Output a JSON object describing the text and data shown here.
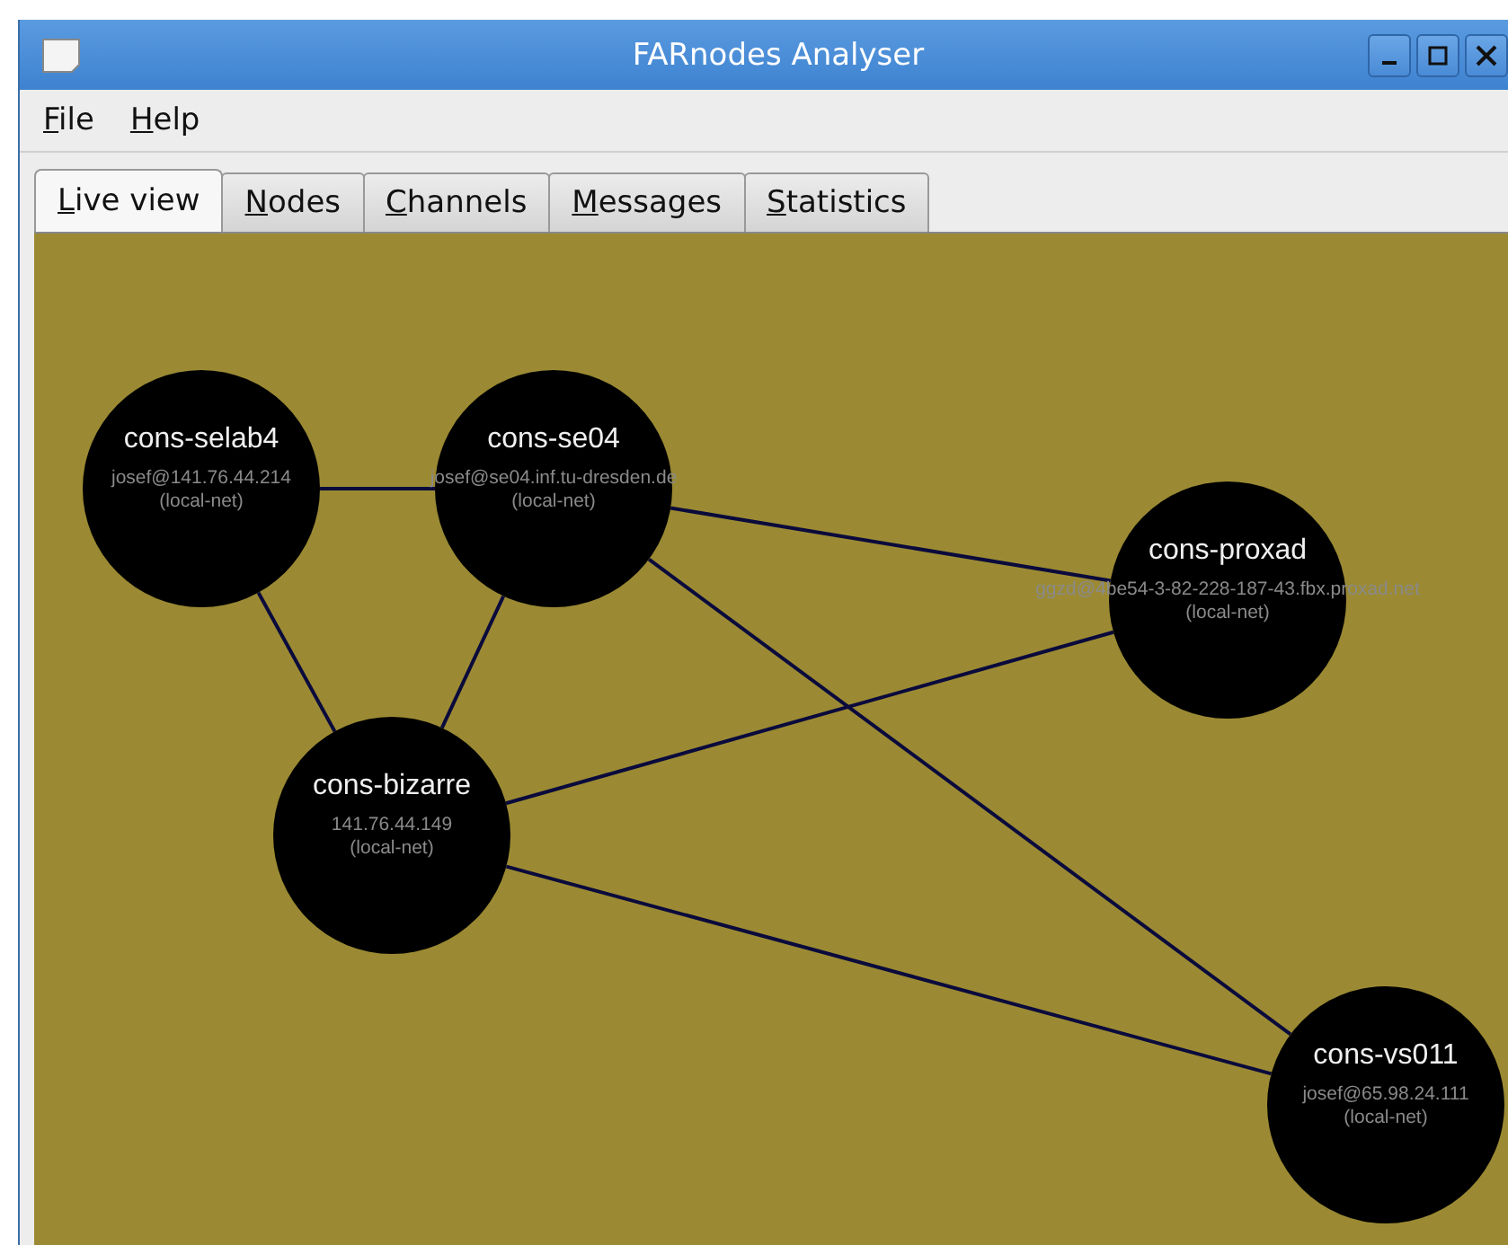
{
  "window": {
    "title": "FARnodes Analyser"
  },
  "menu": [
    {
      "label": "File"
    },
    {
      "label": "Help"
    }
  ],
  "tabs": [
    {
      "label": "Live view",
      "selected": true
    },
    {
      "label": "Nodes",
      "selected": false
    },
    {
      "label": "Channels",
      "selected": false
    },
    {
      "label": "Messages",
      "selected": false
    },
    {
      "label": "Statistics",
      "selected": false
    }
  ],
  "nodes": [
    {
      "name": "cons-selab4",
      "address": "josef@141.76.44.214",
      "network": "(local-net)"
    },
    {
      "name": "cons-se04",
      "address": "josef@se04.inf.tu-dresden.de",
      "network": "(local-net)"
    },
    {
      "name": "cons-proxad",
      "address": "ggzd@4be54-3-82-228-187-43.fbx.proxad.net",
      "network": "(local-net)"
    },
    {
      "name": "cons-bizarre",
      "address": "141.76.44.149",
      "network": "(local-net)"
    },
    {
      "name": "cons-vs011",
      "address": "josef@65.98.24.111",
      "network": "(local-net)"
    }
  ]
}
